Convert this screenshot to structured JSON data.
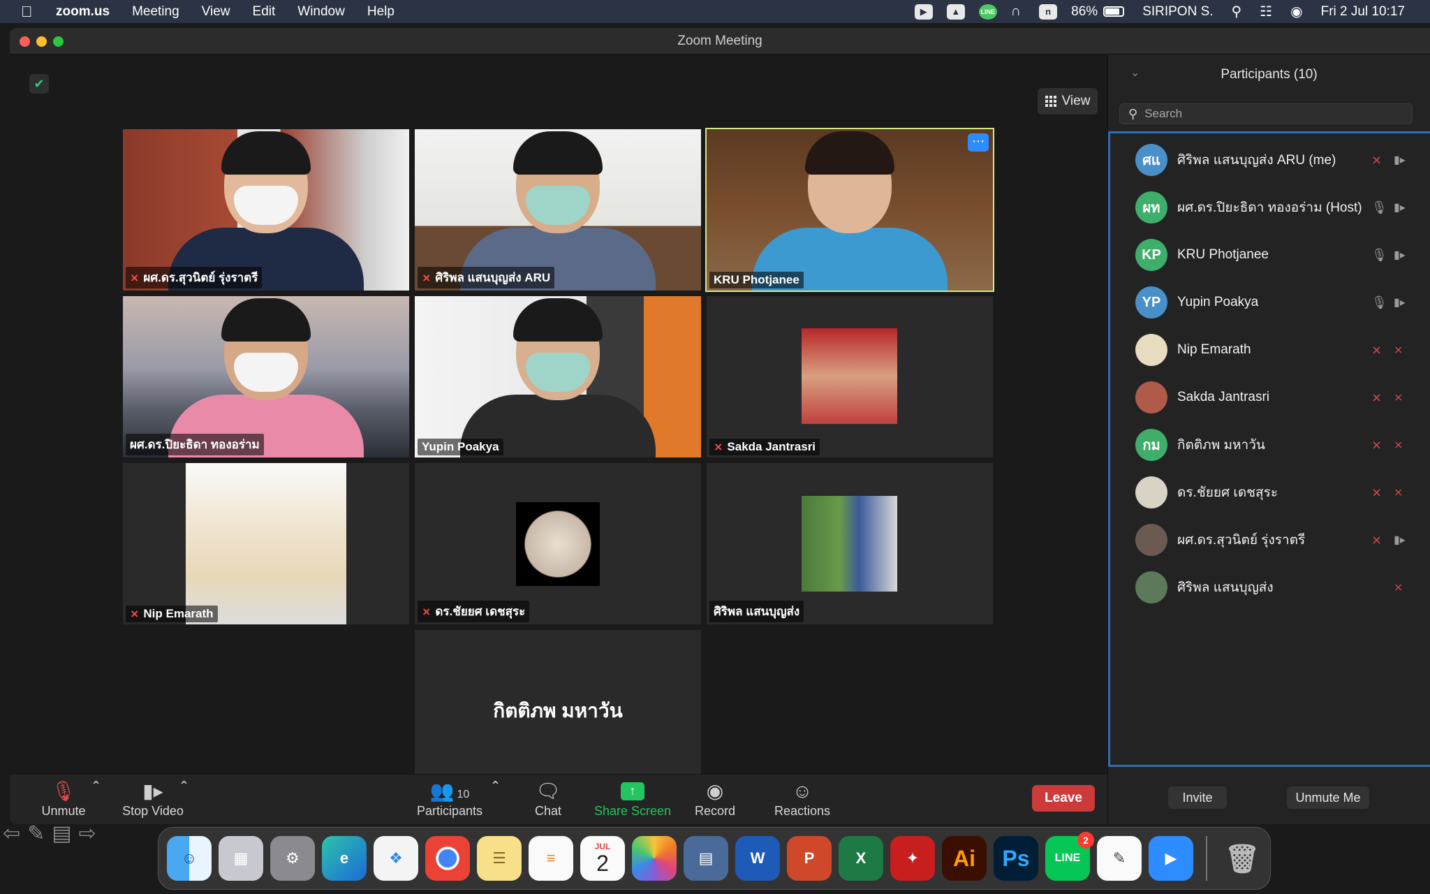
{
  "menubar": {
    "app_name": "zoom.us",
    "menus": [
      "Meeting",
      "View",
      "Edit",
      "Window",
      "Help"
    ],
    "tray_icons": [
      "zoom-tray-icon",
      "drive-tray-icon",
      "line-tray-icon",
      "airpods-icon",
      "notion-icon"
    ],
    "battery": "86%",
    "user": "SIRIPON S.",
    "clock": "Fri 2 Jul  10:17"
  },
  "window": {
    "title": "Zoom Meeting"
  },
  "video": {
    "view_label": "View",
    "tiles": [
      {
        "name": "ผศ.ดร.สุวนิตย์ รุ่งราตรี",
        "muted": true
      },
      {
        "name": "ศิริพล แสนบุญส่ง ARU",
        "muted": true
      },
      {
        "name": "KRU Photjanee",
        "muted": false,
        "active": true
      },
      {
        "name": "ผศ.ดร.ปิยะธิดา ทองอร่าม",
        "muted": false
      },
      {
        "name": "Yupin Poakya",
        "muted": false
      },
      {
        "name": "Sakda Jantrasri",
        "muted": true
      },
      {
        "name": "Nip Emarath",
        "muted": true
      },
      {
        "name": "ดร.ชัยยศ เดชสุระ",
        "muted": true
      },
      {
        "name": "ศิริพล แสนบุญส่ง",
        "muted": false
      },
      {
        "name": "กิตติภพ มหาวัน",
        "muted": true,
        "center_name": true
      }
    ]
  },
  "controls": {
    "unmute": "Unmute",
    "stop_video": "Stop Video",
    "participants": "Participants",
    "participants_count": "10",
    "chat": "Chat",
    "share_screen": "Share Screen",
    "record": "Record",
    "reactions": "Reactions",
    "leave": "Leave"
  },
  "panel": {
    "title": "Participants (10)",
    "search_placeholder": "Search",
    "participants": [
      {
        "initials": "ศแ",
        "name": "ศิริพล แสนบุญส่ง ARU (me)",
        "color": "#4a90c8",
        "mic": "off",
        "cam": "on"
      },
      {
        "initials": "ผท",
        "name": "ผศ.ดร.ปิยะธิดา ทองอร่าม (Host)",
        "color": "#3fae6a",
        "mic": "on",
        "cam": "on"
      },
      {
        "initials": "KP",
        "name": "KRU Photjanee",
        "color": "#3fae6a",
        "mic": "on",
        "cam": "on"
      },
      {
        "initials": "YP",
        "name": "Yupin Poakya",
        "color": "#4a90c8",
        "mic": "on",
        "cam": "on"
      },
      {
        "initials": "",
        "name": "Nip Emarath",
        "color": "#e8dcc0",
        "mic": "off",
        "cam": "off"
      },
      {
        "initials": "",
        "name": "Sakda Jantrasri",
        "color": "#b05a4a",
        "mic": "off",
        "cam": "off"
      },
      {
        "initials": "กม",
        "name": "กิตติภพ มหาวัน",
        "color": "#3fae6a",
        "mic": "off",
        "cam": "off"
      },
      {
        "initials": "",
        "name": "ดร.ชัยยศ เดชสุระ",
        "color": "#d9d3c6",
        "mic": "off",
        "cam": "off"
      },
      {
        "initials": "",
        "name": "ผศ.ดร.สุวนิตย์ รุ่งราตรี",
        "color": "#6a5a52",
        "mic": "off",
        "cam": "on"
      },
      {
        "initials": "",
        "name": "ศิริพล แสนบุญส่ง",
        "color": "#5c7a5a",
        "mic": "none",
        "cam": "off"
      }
    ],
    "invite": "Invite",
    "unmute_me": "Unmute Me"
  },
  "dock": {
    "apps": [
      "Finder",
      "Launchpad",
      "System Preferences",
      "Edge",
      "Safari",
      "Chrome",
      "Notes",
      "Reminders",
      "Calendar",
      "Photos",
      "Screen Share",
      "Word",
      "PowerPoint",
      "Excel",
      "Acrobat",
      "Illustrator",
      "Photoshop",
      "LINE",
      "TextEdit",
      "Zoom",
      "Trash"
    ],
    "calendar_month": "JUL",
    "calendar_day": "2",
    "line_badge": "2",
    "illustrator_label": "Ai",
    "photoshop_label": "Ps",
    "line_label": "LINE"
  }
}
